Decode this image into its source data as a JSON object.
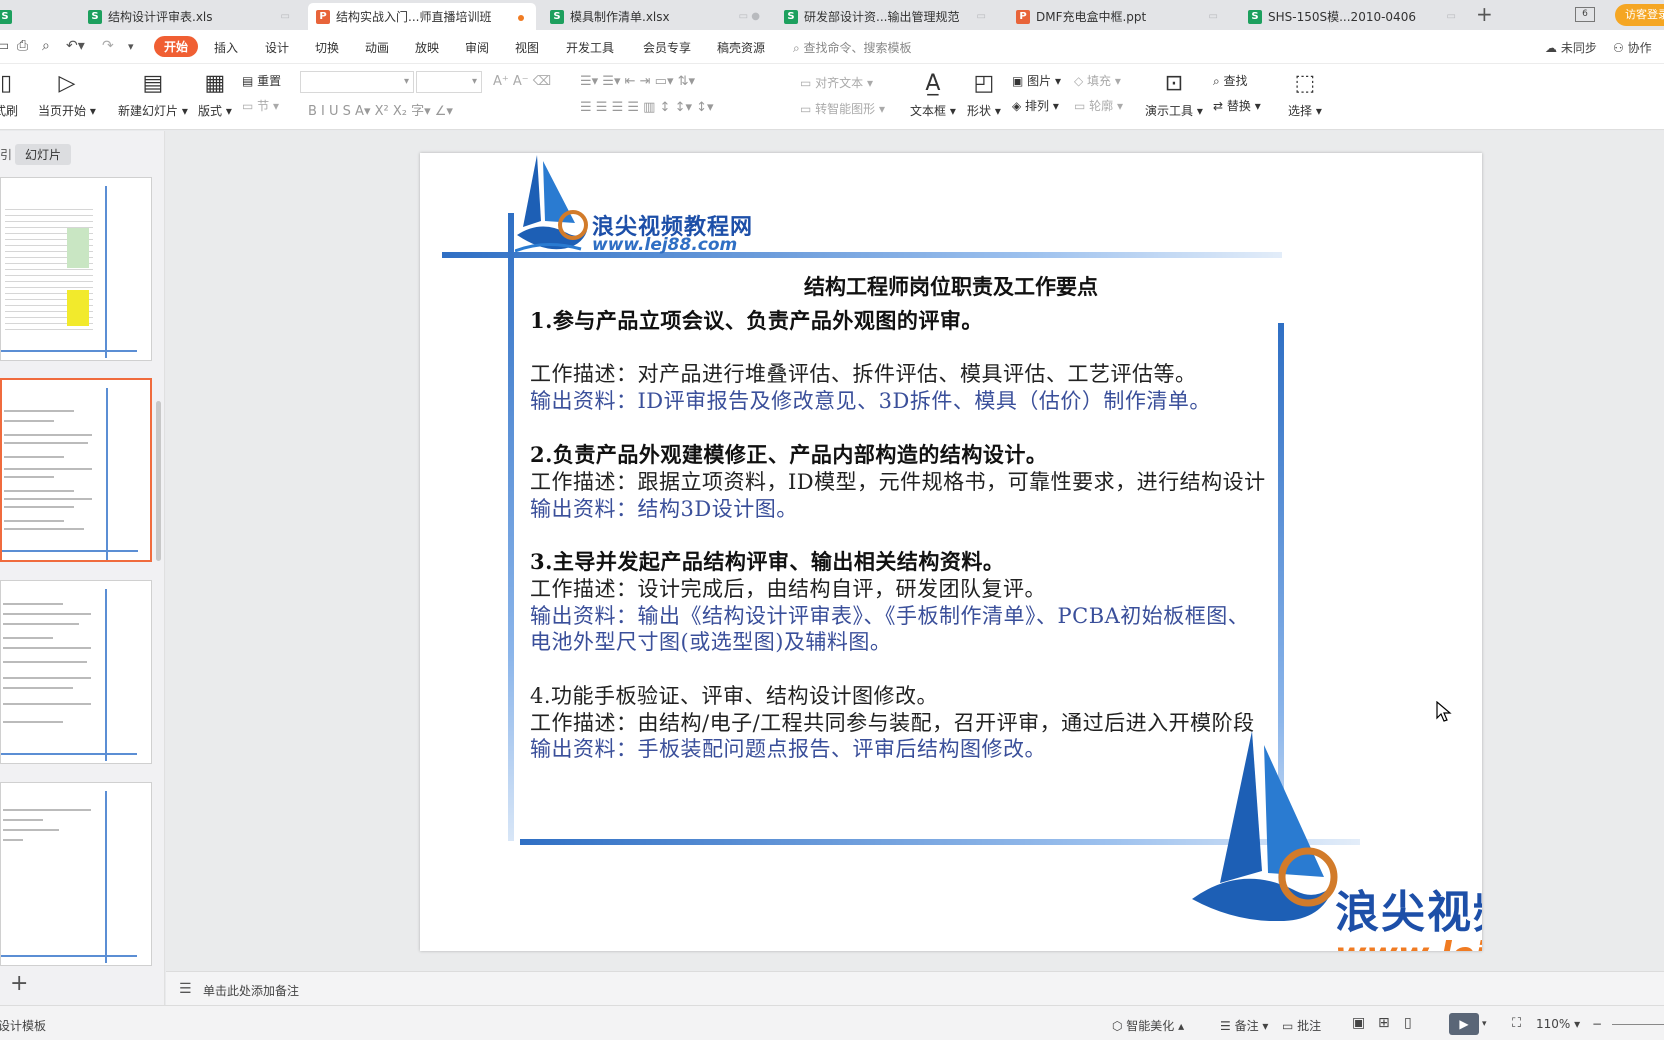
{
  "tabs": [
    {
      "label": "结构设计评审表.xls",
      "type": "S"
    },
    {
      "label": "结构实战入门...师直播培训班",
      "type": "P",
      "active": true
    },
    {
      "label": "模具制作清单.xlsx",
      "type": "S"
    },
    {
      "label": "研发部设计资...输出管理规范",
      "type": "S"
    },
    {
      "label": "DMF充电盒中框.ppt",
      "type": "P"
    },
    {
      "label": "SHS-150S模...2010-0406",
      "type": "S"
    }
  ],
  "window": {
    "new_tab": "+",
    "badge": "6",
    "login": "访客登录"
  },
  "menu": {
    "items": [
      "开始",
      "插入",
      "设计",
      "切换",
      "动画",
      "放映",
      "审阅",
      "视图",
      "开发工具",
      "会员专享",
      "稿壳资源"
    ],
    "search": "查找命令、搜索模板",
    "sync": "未同步",
    "collab": "协作"
  },
  "ribbon": {
    "format_painter": "式刷",
    "play_from_current": "当页开始",
    "new_slide": "新建幻灯片",
    "layout": "版式",
    "reset": "重置",
    "section": "节",
    "align_text": "对齐文本",
    "smart_shape": "转智能图形",
    "textbox": "文本框",
    "shape": "形状",
    "picture": "图片",
    "fill": "填充",
    "arrange": "排列",
    "outline": "轮廓",
    "present_tools": "演示工具",
    "find": "查找",
    "replace": "替换",
    "select": "选择"
  },
  "sidebar": {
    "tab_outline": "引",
    "tab_slides": "幻灯片",
    "add": "+"
  },
  "slide": {
    "logo_cn": "浪尖视频教程网",
    "logo_url": "www.lej88.com",
    "title": "结构工程师岗位职责及工作要点",
    "lines": [
      {
        "kind": "head",
        "text": "1.参与产品立项会议、负责产品外观图的评审。"
      },
      {
        "kind": "desc",
        "text": "工作描述：对产品进行堆叠评估、拆件评估、模具评估、工艺评估等。"
      },
      {
        "kind": "out",
        "text": "输出资料：ID评审报告及修改意见、3D拆件、模具（估价）制作清单。"
      },
      {
        "kind": "head",
        "text": "2.负责产品外观建模修正、产品内部构造的结构设计。"
      },
      {
        "kind": "desc",
        "text": "工作描述：跟据立项资料，ID模型，元件规格书，可靠性要求，进行结构设计"
      },
      {
        "kind": "out",
        "text": "输出资料：结构3D设计图。"
      },
      {
        "kind": "head",
        "text": "3.主导并发起产品结构评审、输出相关结构资料。"
      },
      {
        "kind": "desc",
        "text": "工作描述：设计完成后，由结构自评，研发团队复评。"
      },
      {
        "kind": "out",
        "text": "输出资料：输出《结构设计评审表》、《手板制作清单》、PCBA初始板框图、"
      },
      {
        "kind": "out",
        "text": "电池外型尺寸图(或选型图)及辅料图。"
      },
      {
        "kind": "head",
        "text": "4.功能手板验证、评审、结构设计图修改。"
      },
      {
        "kind": "desc",
        "text": "工作描述：由结构/电子/工程共同参与装配，召开评审，通过后进入开模阶段"
      },
      {
        "kind": "out",
        "text": "输出资料：手板装配问题点报告、评审后结构图修改。"
      }
    ]
  },
  "notes": {
    "placeholder": "单击此处添加备注"
  },
  "status": {
    "template": "设计模板",
    "beautify": "智能美化",
    "notes": "备注",
    "comment": "批注",
    "zoom": "110%"
  }
}
